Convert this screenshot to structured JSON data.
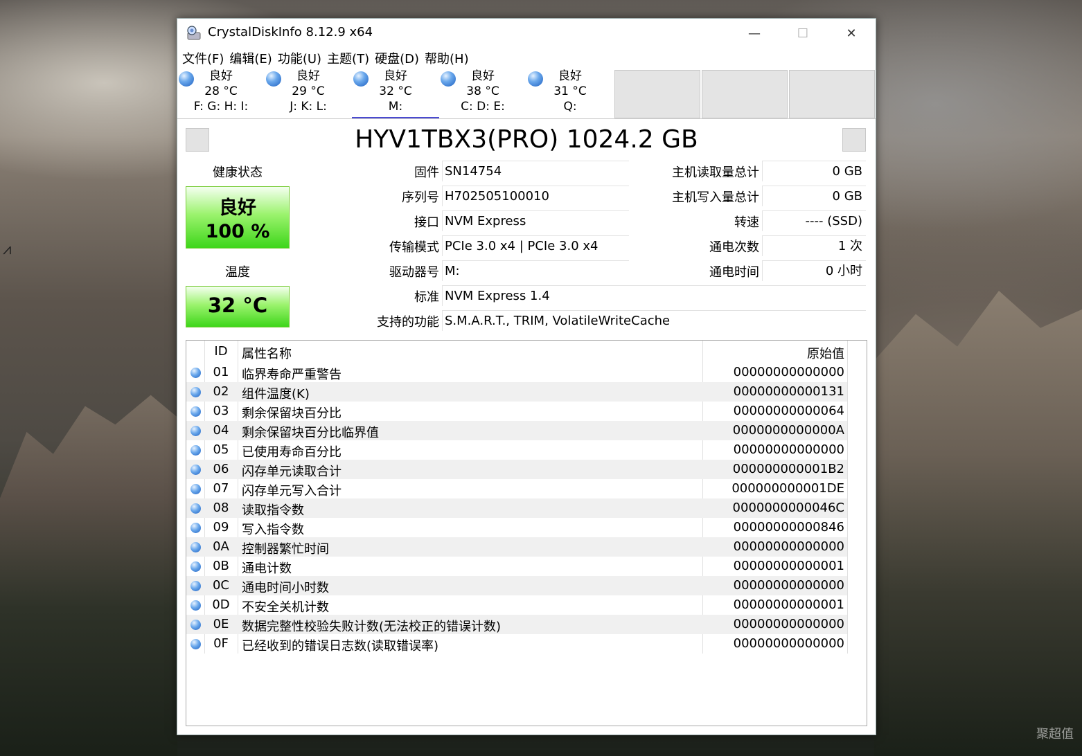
{
  "window": {
    "title": "CrystalDiskInfo 8.12.9 x64",
    "minimize": "—",
    "maximize": "☐",
    "close": "✕"
  },
  "menu": [
    "文件(F)",
    "编辑(E)",
    "功能(U)",
    "主题(T)",
    "硬盘(D)",
    "帮助(H)"
  ],
  "drives": [
    {
      "status": "良好",
      "temp": "28 °C",
      "letters": "F: G: H: I:"
    },
    {
      "status": "良好",
      "temp": "29 °C",
      "letters": "J: K: L:"
    },
    {
      "status": "良好",
      "temp": "32 °C",
      "letters": "M:"
    },
    {
      "status": "良好",
      "temp": "38 °C",
      "letters": "C: D: E:"
    },
    {
      "status": "良好",
      "temp": "31 °C",
      "letters": "Q:"
    }
  ],
  "active_drive": 2,
  "model": "HYV1TBX3(PRO) 1024.2 GB",
  "health": {
    "label": "健康状态",
    "status": "良好",
    "percent": "100 %",
    "color": "#3ed61a"
  },
  "temperature": {
    "label": "温度",
    "value": "32 °C"
  },
  "info_left": [
    {
      "label": "固件",
      "value": "SN14754"
    },
    {
      "label": "序列号",
      "value": "H702505100010"
    },
    {
      "label": "接口",
      "value": "NVM Express"
    },
    {
      "label": "传输模式",
      "value": "PCIe 3.0 x4 | PCIe 3.0 x4"
    },
    {
      "label": "驱动器号",
      "value": "M:"
    },
    {
      "label": "标准",
      "value": "NVM Express 1.4"
    },
    {
      "label": "支持的功能",
      "value": "S.M.A.R.T., TRIM, VolatileWriteCache"
    }
  ],
  "info_right": [
    {
      "label": "主机读取量总计",
      "value": "0 GB"
    },
    {
      "label": "主机写入量总计",
      "value": "0 GB"
    },
    {
      "label": "转速",
      "value": "---- (SSD)"
    },
    {
      "label": "通电次数",
      "value": "1 次"
    },
    {
      "label": "通电时间",
      "value": "0 小时"
    }
  ],
  "smart": {
    "headers": {
      "id": "ID",
      "name": "属性名称",
      "raw": "原始值"
    },
    "rows": [
      {
        "id": "01",
        "name": "临界寿命严重警告",
        "raw": "00000000000000"
      },
      {
        "id": "02",
        "name": "组件温度(K)",
        "raw": "00000000000131"
      },
      {
        "id": "03",
        "name": "剩余保留块百分比",
        "raw": "00000000000064"
      },
      {
        "id": "04",
        "name": "剩余保留块百分比临界值",
        "raw": "0000000000000A"
      },
      {
        "id": "05",
        "name": "已使用寿命百分比",
        "raw": "00000000000000"
      },
      {
        "id": "06",
        "name": "闪存单元读取合计",
        "raw": "000000000001B2"
      },
      {
        "id": "07",
        "name": "闪存单元写入合计",
        "raw": "000000000001DE"
      },
      {
        "id": "08",
        "name": "读取指令数",
        "raw": "0000000000046C"
      },
      {
        "id": "09",
        "name": "写入指令数",
        "raw": "00000000000846"
      },
      {
        "id": "0A",
        "name": "控制器繁忙时间",
        "raw": "00000000000000"
      },
      {
        "id": "0B",
        "name": "通电计数",
        "raw": "00000000000001"
      },
      {
        "id": "0C",
        "name": "通电时间小时数",
        "raw": "00000000000000"
      },
      {
        "id": "0D",
        "name": "不安全关机计数",
        "raw": "00000000000001"
      },
      {
        "id": "0E",
        "name": "数据完整性校验失败计数(无法校正的错误计数)",
        "raw": "00000000000000"
      },
      {
        "id": "0F",
        "name": "已经收到的错误日志数(读取错误率)",
        "raw": "00000000000000"
      }
    ]
  },
  "desktop": {
    "watermark": "聚超值"
  }
}
